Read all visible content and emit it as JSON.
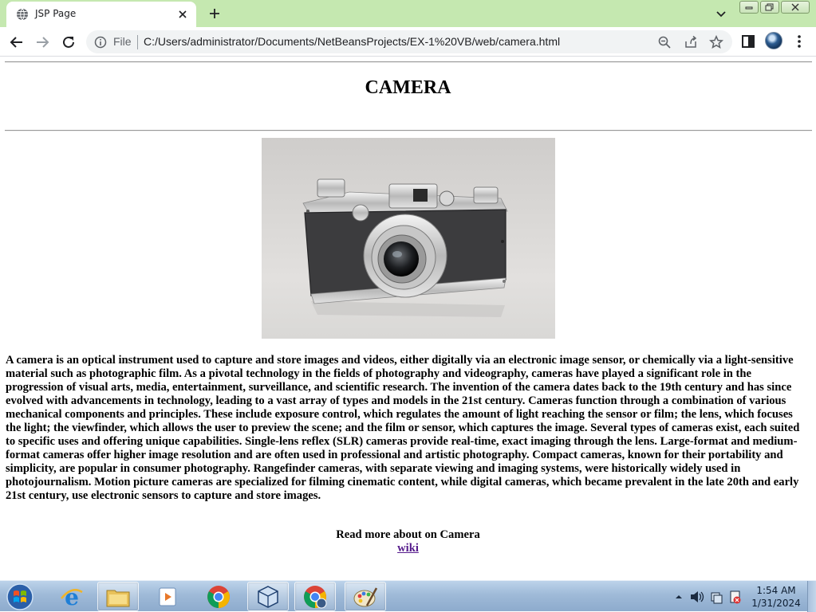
{
  "browser": {
    "tab_title": "JSP Page",
    "scheme_label": "File",
    "url": "C:/Users/administrator/Documents/NetBeansProjects/EX-1%20VB/web/camera.html"
  },
  "page": {
    "title": "CAMERA",
    "image_alt": "camera",
    "article": "A camera is an optical instrument used to capture and store images and videos, either digitally via an electronic image sensor, or chemically via a light-sensitive material such as photographic film. As a pivotal technology in the fields of photography and videography, cameras have played a significant role in the progression of visual arts, media, entertainment, surveillance, and scientific research. The invention of the camera dates back to the 19th century and has since evolved with advancements in technology, leading to a vast array of types and models in the 21st century. Cameras function through a combination of various mechanical components and principles. These include exposure control, which regulates the amount of light reaching the sensor or film; the lens, which focuses the light; the viewfinder, which allows the user to preview the scene; and the film or sensor, which captures the image. Several types of cameras exist, each suited to specific uses and offering unique capabilities. Single-lens reflex (SLR) cameras provide real-time, exact imaging through the lens. Large-format and medium-format cameras offer higher image resolution and are often used in professional and artistic photography. Compact cameras, known for their portability and simplicity, are popular in consumer photography. Rangefinder cameras, with separate viewing and imaging systems, were historically widely used in photojournalism. Motion picture cameras are specialized for filming cinematic content, while digital cameras, which became prevalent in the late 20th and early 21st century, use electronic sensors to capture and store images.",
    "read_more_label": "Read more about on Camera",
    "wiki_link": "wiki"
  },
  "taskbar": {
    "apps": [
      {
        "name": "internet-explorer-icon"
      },
      {
        "name": "file-explorer-icon"
      },
      {
        "name": "media-player-icon"
      },
      {
        "name": "chrome-icon"
      },
      {
        "name": "virtualbox-icon"
      },
      {
        "name": "chrome-active-icon"
      },
      {
        "name": "paint-icon"
      }
    ],
    "clock_time": "1:54 AM",
    "clock_date": "1/31/2024"
  },
  "colors": {
    "tabstrip": "#c5e8b0",
    "link": "#551a8b",
    "taskbar": "#9fbad8"
  }
}
